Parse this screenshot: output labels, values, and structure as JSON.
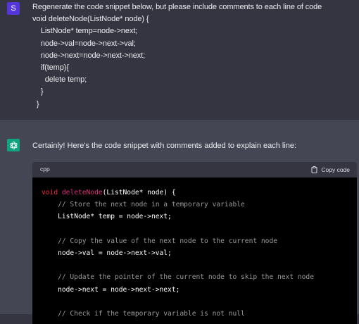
{
  "user": {
    "avatar_letter": "S",
    "message": "Regenerate the code snippet below, but please include comments to each line of code\nvoid deleteNode(ListNode* node) {\n    ListNode* temp=node->next;\n    node->val=node->next->val;\n    node->next=node->next->next;\n    if(temp){\n      delete temp;\n    }\n  }"
  },
  "assistant": {
    "avatar_icon": "openai-logo-icon",
    "intro": "Certainly! Here's the code snippet with comments added to explain each line:",
    "code_block": {
      "language": "cpp",
      "copy_label": "Copy code",
      "lines": [
        [
          {
            "t": "kw",
            "v": "void "
          },
          {
            "t": "fn",
            "v": "deleteNode"
          },
          {
            "t": "pl",
            "v": "(ListNode* node) {"
          }
        ],
        [
          {
            "t": "cm",
            "v": "    // Store the next node in a temporary variable"
          }
        ],
        [
          {
            "t": "pl",
            "v": "    ListNode* temp = node->next;"
          }
        ],
        [
          {
            "t": "pl",
            "v": ""
          }
        ],
        [
          {
            "t": "cm",
            "v": "    // Copy the value of the next node to the current node"
          }
        ],
        [
          {
            "t": "pl",
            "v": "    node->val = node->next->val;"
          }
        ],
        [
          {
            "t": "pl",
            "v": ""
          }
        ],
        [
          {
            "t": "cm",
            "v": "    // Update the pointer of the current node to skip the next node"
          }
        ],
        [
          {
            "t": "pl",
            "v": "    node->next = node->next->next;"
          }
        ],
        [
          {
            "t": "pl",
            "v": ""
          }
        ],
        [
          {
            "t": "cm",
            "v": "    // Check if the temporary variable is not null"
          }
        ]
      ]
    }
  },
  "colors": {
    "background": "#343541",
    "assistant_background": "#444654",
    "user_avatar": "#5436da",
    "assistant_avatar": "#10a37f",
    "code_background": "#000000",
    "keyword": "#f22c3d",
    "function": "#df3079",
    "comment": "#9a9a9a"
  }
}
